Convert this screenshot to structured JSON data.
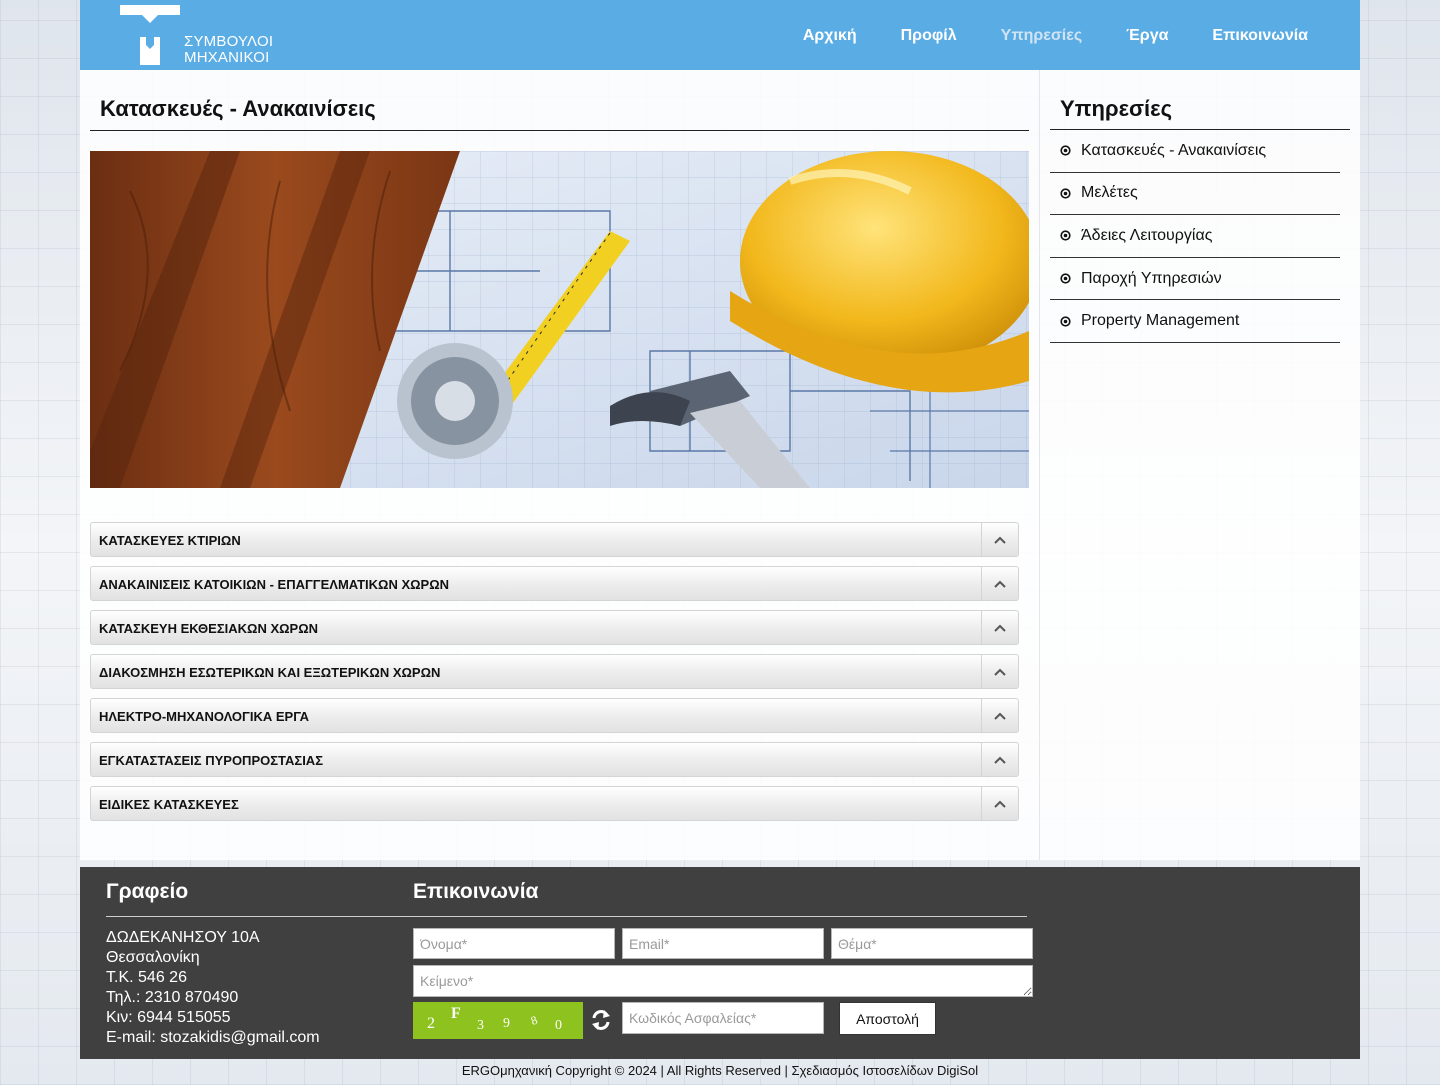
{
  "header": {
    "logo_line1": "ΣΥΜΒΟΥΛΟΙ",
    "logo_line2": "ΜΗΧΑΝΙΚΟΙ",
    "nav": [
      {
        "label": "Αρχική"
      },
      {
        "label": "Προφίλ"
      },
      {
        "label": "Υπηρεσίες",
        "active": true
      },
      {
        "label": "Έργα"
      },
      {
        "label": "Επικοινωνία"
      }
    ]
  },
  "main": {
    "title": "Κατασκευές - Ανακαινίσεις",
    "accordion": [
      {
        "label": "ΚΑΤΑΣΚΕΥΕΣ ΚΤΙΡΙΩΝ"
      },
      {
        "label": "ΑΝΑΚΑΙΝΙΣΕΙΣ ΚΑΤΟΙΚΙΩΝ - ΕΠΑΓΓΕΛΜΑΤΙΚΩΝ ΧΩΡΩΝ"
      },
      {
        "label": "ΚΑΤΑΣΚΕΥΗ ΕΚΘΕΣΙΑΚΩΝ ΧΩΡΩΝ"
      },
      {
        "label": "ΔΙΑΚΟΣΜΗΣΗ ΕΣΩΤΕΡΙΚΩΝ ΚΑΙ ΕΞΩΤΕΡΙΚΩΝ ΧΩΡΩΝ"
      },
      {
        "label": "ΗΛΕΚΤΡΟ-ΜΗΧΑΝΟΛΟΓΙΚΑ ΕΡΓΑ"
      },
      {
        "label": "ΕΓΚΑΤΑΣΤΑΣΕΙΣ ΠΥΡΟΠΡΟΣΤΑΣΙΑΣ"
      },
      {
        "label": "ΕΙΔΙΚΕΣ ΚΑΤΑΣΚΕΥΕΣ"
      }
    ]
  },
  "sidebar": {
    "title": "Υπηρεσίες",
    "items": [
      {
        "label": "Κατασκευές - Ανακαινίσεις"
      },
      {
        "label": "Μελέτες"
      },
      {
        "label": "Άδειες Λειτουργίας"
      },
      {
        "label": "Παροχή Υπηρεσιών"
      },
      {
        "label": "Property Management"
      }
    ]
  },
  "footer": {
    "office_title": "Γραφείο",
    "contact_title": "Επικοινωνία",
    "address": {
      "street": "ΔΩΔΕΚΑΝΗΣΟΥ 10Α",
      "city": "Θεσσαλονίκη",
      "postcode": "Τ.Κ. 546 26",
      "phone": "Τηλ.: 2310 870490",
      "mobile": "Κιν: 6944 515055",
      "email": "E-mail: stozakidis@gmail.com"
    },
    "form": {
      "name_placeholder": "Όνομα*",
      "email_placeholder": "Email*",
      "subject_placeholder": "Θέμα*",
      "message_placeholder": "Κείμενο*",
      "captcha_placeholder": "Κωδικός Ασφαλείας*",
      "captcha_text": [
        "2",
        "F",
        "3",
        "9",
        "8",
        "0"
      ],
      "submit_label": "Αποστολή"
    },
    "copyright": "ERGOμηχανική Copyright © 2024 | All Rights Reserved | Σχεδιασμός Ιστοσελίδων DigiSol"
  },
  "colors": {
    "header_bg": "#5aace4",
    "footer_bg": "#404040",
    "captcha_bg": "#8dc21f"
  }
}
